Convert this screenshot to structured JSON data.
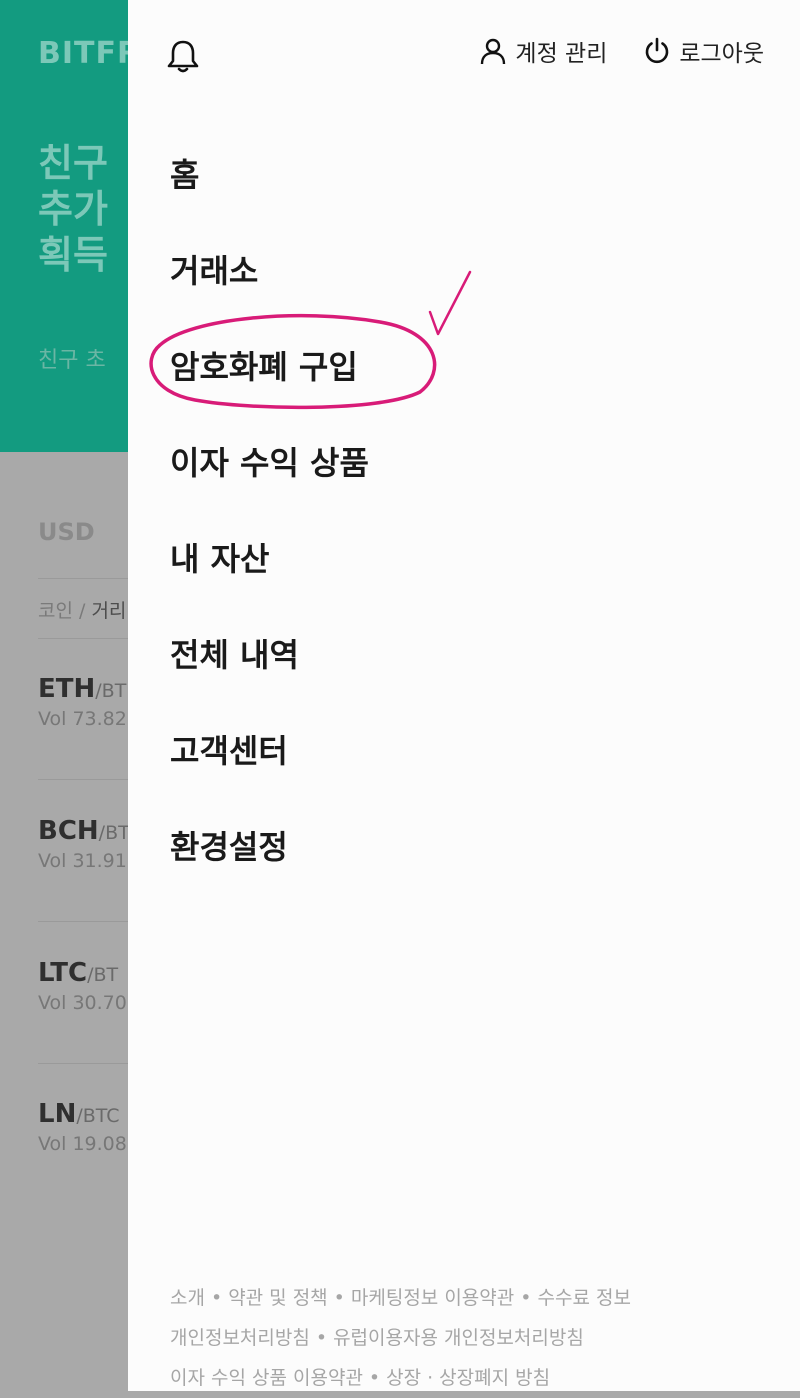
{
  "background": {
    "logo": "BITFR",
    "hero_lines": [
      "친구",
      "추가",
      "획득"
    ],
    "hero_sub": "친구 초",
    "currency": "USD",
    "sort_prefix": "코인 / ",
    "sort_active": "거리",
    "coins": [
      {
        "symbol": "ETH",
        "pair": "/BT",
        "vol": "Vol 73.82"
      },
      {
        "symbol": "BCH",
        "pair": "/BT",
        "vol": "Vol 31.91"
      },
      {
        "symbol": "LTC",
        "pair": "/BT",
        "vol": "Vol 30.70"
      },
      {
        "symbol": "LN",
        "pair": "/BTC",
        "vol": "Vol 19.08"
      }
    ]
  },
  "drawer": {
    "account_label": "계정 관리",
    "logout_label": "로그아웃",
    "menu": [
      "홈",
      "거래소",
      "암호화폐 구입",
      "이자 수익 상품",
      "내 자산",
      "전체 내역",
      "고객센터",
      "환경설정"
    ],
    "footer": {
      "line1": [
        "소개",
        "약관 및 정책",
        "마케팅정보 이용약관",
        "수수료 정보"
      ],
      "line2": [
        "개인정보처리방침",
        "유럽이용자용 개인정보처리방침"
      ],
      "line3": [
        "이자 수익 상품 이용약관",
        "상장",
        "상장폐지 방침"
      ]
    }
  },
  "colors": {
    "brand": "#139b80",
    "annotation": "#d81b78"
  }
}
